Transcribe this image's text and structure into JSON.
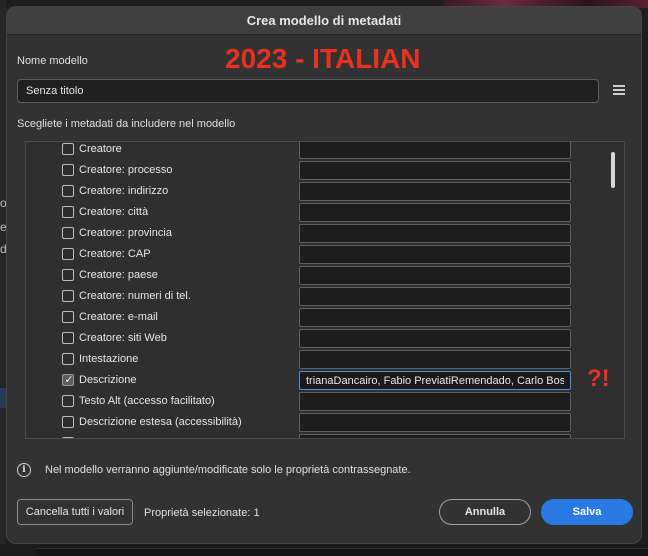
{
  "dialog": {
    "title": "Crea modello di metadati",
    "name_label": "Nome modello",
    "name_value": "Senza titolo",
    "instructions": "Scegliete i metadati da includere nel modello",
    "info_text": "Nel modello verranno aggiunte/modificate solo le proprietà contrassegnate.",
    "clear_button": "Cancella tutti i valori",
    "selected_count": "Proprietà selezionate: 1",
    "cancel_button": "Annulla",
    "save_button": "Salva",
    "accent_color": "#2a7ae4"
  },
  "overlay": {
    "banner": "2023 - ITALIAN",
    "marks": "?!",
    "color": "#e8311f"
  },
  "background": {
    "fragments": [
      "oc",
      "e",
      "do"
    ]
  },
  "fields": [
    {
      "label": "Creatore",
      "checked": false,
      "value": ""
    },
    {
      "label": "Creatore: processo",
      "checked": false,
      "value": ""
    },
    {
      "label": "Creatore: indirizzo",
      "checked": false,
      "value": ""
    },
    {
      "label": "Creatore: città",
      "checked": false,
      "value": ""
    },
    {
      "label": "Creatore: provincia",
      "checked": false,
      "value": ""
    },
    {
      "label": "Creatore: CAP",
      "checked": false,
      "value": ""
    },
    {
      "label": "Creatore: paese",
      "checked": false,
      "value": ""
    },
    {
      "label": "Creatore: numeri di tel.",
      "checked": false,
      "value": ""
    },
    {
      "label": "Creatore: e-mail",
      "checked": false,
      "value": ""
    },
    {
      "label": "Creatore: siti Web",
      "checked": false,
      "value": ""
    },
    {
      "label": "Intestazione",
      "checked": false,
      "value": ""
    },
    {
      "label": "Descrizione",
      "checked": true,
      "value": "trianaDancairo, Fabio PreviatiRemendado, Carlo Bosq"
    },
    {
      "label": "Testo Alt (accesso facilitato)",
      "checked": false,
      "value": ""
    },
    {
      "label": "Descrizione estesa (accessibilità)",
      "checked": false,
      "value": ""
    },
    {
      "label": "",
      "checked": false,
      "value": ""
    }
  ]
}
